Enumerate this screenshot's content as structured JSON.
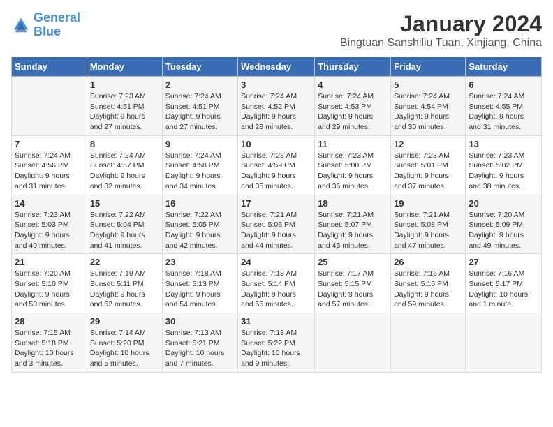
{
  "logo": {
    "text_general": "General",
    "text_blue": "Blue"
  },
  "title": "January 2024",
  "subtitle": "Bingtuan Sanshiliu Tuan, Xinjiang, China",
  "days_of_week": [
    "Sunday",
    "Monday",
    "Tuesday",
    "Wednesday",
    "Thursday",
    "Friday",
    "Saturday"
  ],
  "weeks": [
    [
      {
        "day": "",
        "content": ""
      },
      {
        "day": "1",
        "content": "Sunrise: 7:23 AM\nSunset: 4:51 PM\nDaylight: 9 hours\nand 27 minutes."
      },
      {
        "day": "2",
        "content": "Sunrise: 7:24 AM\nSunset: 4:51 PM\nDaylight: 9 hours\nand 27 minutes."
      },
      {
        "day": "3",
        "content": "Sunrise: 7:24 AM\nSunset: 4:52 PM\nDaylight: 9 hours\nand 28 minutes."
      },
      {
        "day": "4",
        "content": "Sunrise: 7:24 AM\nSunset: 4:53 PM\nDaylight: 9 hours\nand 29 minutes."
      },
      {
        "day": "5",
        "content": "Sunrise: 7:24 AM\nSunset: 4:54 PM\nDaylight: 9 hours\nand 30 minutes."
      },
      {
        "day": "6",
        "content": "Sunrise: 7:24 AM\nSunset: 4:55 PM\nDaylight: 9 hours\nand 31 minutes."
      }
    ],
    [
      {
        "day": "7",
        "content": "Sunrise: 7:24 AM\nSunset: 4:56 PM\nDaylight: 9 hours\nand 31 minutes."
      },
      {
        "day": "8",
        "content": "Sunrise: 7:24 AM\nSunset: 4:57 PM\nDaylight: 9 hours\nand 32 minutes."
      },
      {
        "day": "9",
        "content": "Sunrise: 7:24 AM\nSunset: 4:58 PM\nDaylight: 9 hours\nand 34 minutes."
      },
      {
        "day": "10",
        "content": "Sunrise: 7:23 AM\nSunset: 4:59 PM\nDaylight: 9 hours\nand 35 minutes."
      },
      {
        "day": "11",
        "content": "Sunrise: 7:23 AM\nSunset: 5:00 PM\nDaylight: 9 hours\nand 36 minutes."
      },
      {
        "day": "12",
        "content": "Sunrise: 7:23 AM\nSunset: 5:01 PM\nDaylight: 9 hours\nand 37 minutes."
      },
      {
        "day": "13",
        "content": "Sunrise: 7:23 AM\nSunset: 5:02 PM\nDaylight: 9 hours\nand 38 minutes."
      }
    ],
    [
      {
        "day": "14",
        "content": "Sunrise: 7:23 AM\nSunset: 5:03 PM\nDaylight: 9 hours\nand 40 minutes."
      },
      {
        "day": "15",
        "content": "Sunrise: 7:22 AM\nSunset: 5:04 PM\nDaylight: 9 hours\nand 41 minutes."
      },
      {
        "day": "16",
        "content": "Sunrise: 7:22 AM\nSunset: 5:05 PM\nDaylight: 9 hours\nand 42 minutes."
      },
      {
        "day": "17",
        "content": "Sunrise: 7:21 AM\nSunset: 5:06 PM\nDaylight: 9 hours\nand 44 minutes."
      },
      {
        "day": "18",
        "content": "Sunrise: 7:21 AM\nSunset: 5:07 PM\nDaylight: 9 hours\nand 45 minutes."
      },
      {
        "day": "19",
        "content": "Sunrise: 7:21 AM\nSunset: 5:08 PM\nDaylight: 9 hours\nand 47 minutes."
      },
      {
        "day": "20",
        "content": "Sunrise: 7:20 AM\nSunset: 5:09 PM\nDaylight: 9 hours\nand 49 minutes."
      }
    ],
    [
      {
        "day": "21",
        "content": "Sunrise: 7:20 AM\nSunset: 5:10 PM\nDaylight: 9 hours\nand 50 minutes."
      },
      {
        "day": "22",
        "content": "Sunrise: 7:19 AM\nSunset: 5:11 PM\nDaylight: 9 hours\nand 52 minutes."
      },
      {
        "day": "23",
        "content": "Sunrise: 7:18 AM\nSunset: 5:13 PM\nDaylight: 9 hours\nand 54 minutes."
      },
      {
        "day": "24",
        "content": "Sunrise: 7:18 AM\nSunset: 5:14 PM\nDaylight: 9 hours\nand 55 minutes."
      },
      {
        "day": "25",
        "content": "Sunrise: 7:17 AM\nSunset: 5:15 PM\nDaylight: 9 hours\nand 57 minutes."
      },
      {
        "day": "26",
        "content": "Sunrise: 7:16 AM\nSunset: 5:16 PM\nDaylight: 9 hours\nand 59 minutes."
      },
      {
        "day": "27",
        "content": "Sunrise: 7:16 AM\nSunset: 5:17 PM\nDaylight: 10 hours\nand 1 minute."
      }
    ],
    [
      {
        "day": "28",
        "content": "Sunrise: 7:15 AM\nSunset: 5:18 PM\nDaylight: 10 hours\nand 3 minutes."
      },
      {
        "day": "29",
        "content": "Sunrise: 7:14 AM\nSunset: 5:20 PM\nDaylight: 10 hours\nand 5 minutes."
      },
      {
        "day": "30",
        "content": "Sunrise: 7:13 AM\nSunset: 5:21 PM\nDaylight: 10 hours\nand 7 minutes."
      },
      {
        "day": "31",
        "content": "Sunrise: 7:13 AM\nSunset: 5:22 PM\nDaylight: 10 hours\nand 9 minutes."
      },
      {
        "day": "",
        "content": ""
      },
      {
        "day": "",
        "content": ""
      },
      {
        "day": "",
        "content": ""
      }
    ]
  ]
}
